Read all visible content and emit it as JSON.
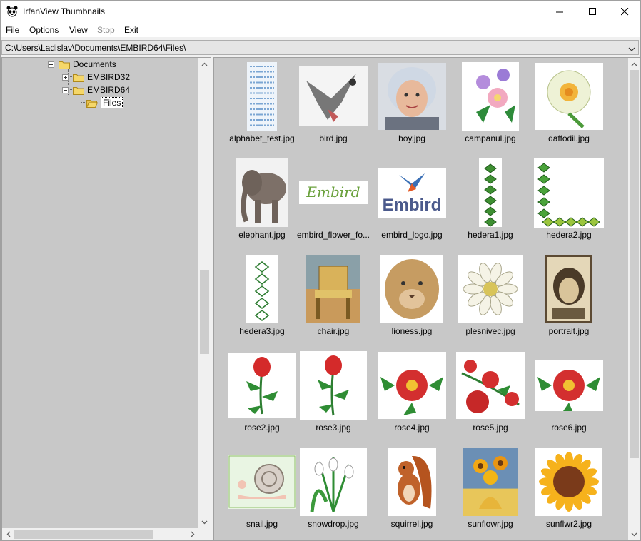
{
  "window": {
    "title": "IrfanView Thumbnails",
    "icon": "irfanview-panda-icon"
  },
  "menu": [
    {
      "label": "File",
      "enabled": true
    },
    {
      "label": "Options",
      "enabled": true
    },
    {
      "label": "View",
      "enabled": true
    },
    {
      "label": "Stop",
      "enabled": false
    },
    {
      "label": "Exit",
      "enabled": true
    }
  ],
  "path": {
    "value": "C:\\Users\\Ladislav\\Documents\\EMBIRD64\\Files\\"
  },
  "tree": [
    {
      "label": "Documents",
      "expander": "minus"
    },
    {
      "label": "EMBIRD32",
      "expander": "plus"
    },
    {
      "label": "EMBIRD64",
      "expander": "minus"
    },
    {
      "label": "Files",
      "expander": "none",
      "selected": true
    }
  ],
  "thumbnails": [
    {
      "name": "alphabet_test.jpg",
      "art": "text"
    },
    {
      "name": "bird.jpg",
      "art": "bird"
    },
    {
      "name": "boy.jpg",
      "art": "boy"
    },
    {
      "name": "campanul.jpg",
      "art": "flowers-purple"
    },
    {
      "name": "daffodil.jpg",
      "art": "daffodil"
    },
    {
      "name": "elephant.jpg",
      "art": "elephant"
    },
    {
      "name": "embird_flower_fo...",
      "art": "embird-text"
    },
    {
      "name": "embird_logo.jpg",
      "art": "embird-logo"
    },
    {
      "name": "hedera1.jpg",
      "art": "ivy-vertical"
    },
    {
      "name": "hedera2.jpg",
      "art": "ivy-corner"
    },
    {
      "name": "hedera3.jpg",
      "art": "ivy-outline"
    },
    {
      "name": "chair.jpg",
      "art": "chair"
    },
    {
      "name": "lioness.jpg",
      "art": "lioness"
    },
    {
      "name": "plesnivec.jpg",
      "art": "edelweiss"
    },
    {
      "name": "portrait.jpg",
      "art": "portrait"
    },
    {
      "name": "rose2.jpg",
      "art": "rose"
    },
    {
      "name": "rose3.jpg",
      "art": "rose"
    },
    {
      "name": "rose4.jpg",
      "art": "rose-open"
    },
    {
      "name": "rose5.jpg",
      "art": "rose-branch"
    },
    {
      "name": "rose6.jpg",
      "art": "rose-open"
    },
    {
      "name": "snail.jpg",
      "art": "snail"
    },
    {
      "name": "snowdrop.jpg",
      "art": "snowdrop"
    },
    {
      "name": "squirrel.jpg",
      "art": "squirrel"
    },
    {
      "name": "sunflowr.jpg",
      "art": "sunflowers-vase"
    },
    {
      "name": "sunflwr2.jpg",
      "art": "sunflower"
    }
  ],
  "colors": {
    "pane_background": "#c8c8c8",
    "folder_yellow": "#f5d769"
  }
}
